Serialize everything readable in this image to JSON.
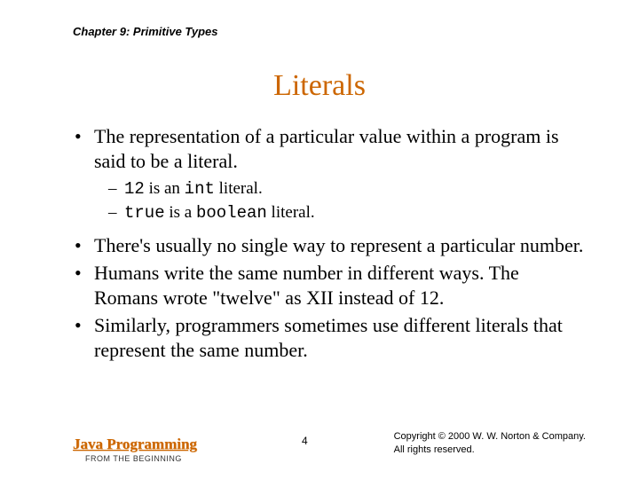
{
  "chapter": "Chapter 9: Primitive Types",
  "title": "Literals",
  "bullets": {
    "b1": "The representation of a particular value within a program is said to be a literal.",
    "b2": "There's usually no single way to represent a particular number.",
    "b3": "Humans write the same number in different ways. The Romans wrote \"twelve\" as XII instead of 12.",
    "b4": "Similarly, programmers sometimes use different literals that represent the same number."
  },
  "sub": {
    "s1_code1": "12",
    "s1_mid": " is an ",
    "s1_code2": "int",
    "s1_end": " literal.",
    "s2_code1": "true",
    "s2_mid": " is a ",
    "s2_code2": "boolean",
    "s2_end": " literal."
  },
  "footer": {
    "book_title": "Java Programming",
    "book_sub": "FROM THE BEGINNING",
    "page": "4",
    "copy1": "Copyright © 2000 W. W. Norton & Company.",
    "copy2": "All rights reserved."
  }
}
